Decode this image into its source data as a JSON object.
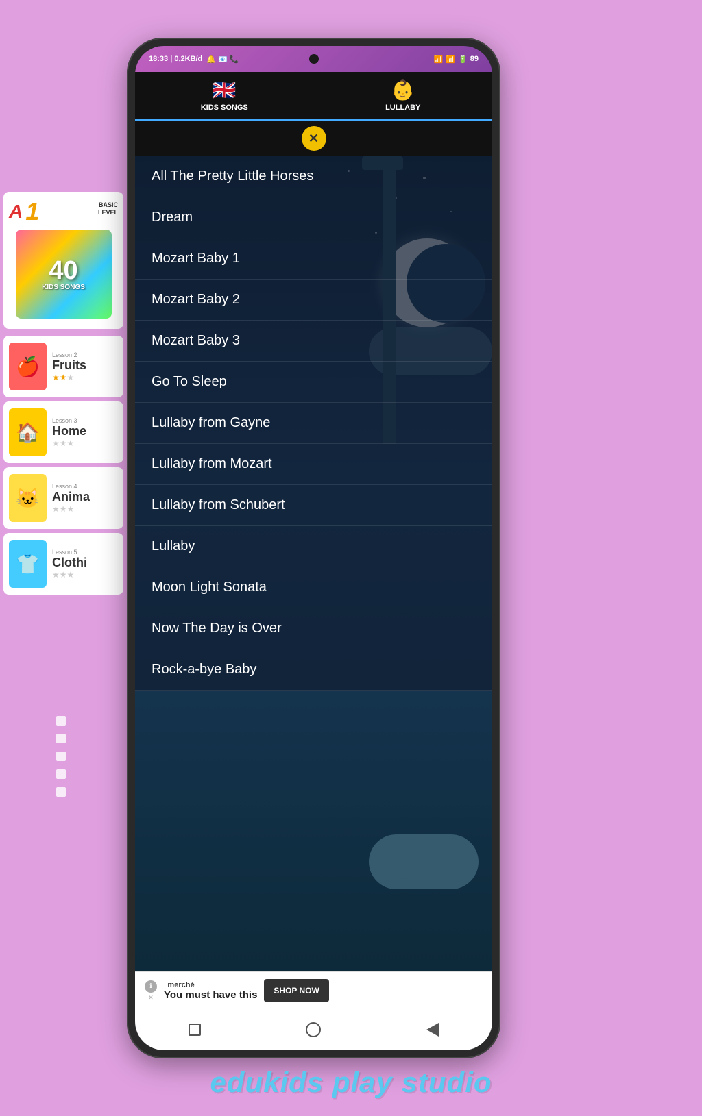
{
  "page": {
    "background_color": "#e0a0e0",
    "branding": "edukids play studio"
  },
  "status_bar": {
    "time": "18:33 | 0,2KB/d",
    "icons_left": "🔔 📧 📞",
    "battery": "89"
  },
  "tabs": [
    {
      "id": "kids-songs",
      "label": "KIDS SONGS",
      "emoji": "🇬🇧",
      "active": false
    },
    {
      "id": "lullaby",
      "label": "LULLABY",
      "emoji": "👶",
      "active": true
    }
  ],
  "close_button_label": "✕",
  "songs": [
    {
      "id": 1,
      "title": "All The Pretty Little Horses"
    },
    {
      "id": 2,
      "title": "Dream"
    },
    {
      "id": 3,
      "title": "Mozart Baby 1"
    },
    {
      "id": 4,
      "title": "Mozart Baby 2"
    },
    {
      "id": 5,
      "title": "Mozart Baby 3"
    },
    {
      "id": 6,
      "title": "Go To Sleep"
    },
    {
      "id": 7,
      "title": "Lullaby from Gayne"
    },
    {
      "id": 8,
      "title": "Lullaby from Mozart"
    },
    {
      "id": 9,
      "title": "Lullaby from Schubert"
    },
    {
      "id": 10,
      "title": "Lullaby"
    },
    {
      "id": 11,
      "title": "Moon Light Sonata"
    },
    {
      "id": 12,
      "title": "Now The Day is Over"
    },
    {
      "id": 13,
      "title": "Rock-a-bye Baby"
    }
  ],
  "ad": {
    "brand": "merche",
    "brand_styled": "merché",
    "text": "You must have this",
    "button_label": "SHOP NOW"
  },
  "sidebar": {
    "top_card": {
      "a1": "A",
      "num": "1",
      "basic_label": "BASIC",
      "level_label": "LEVEL",
      "forty": "40",
      "kids_songs": "KIDS SONGS"
    },
    "lessons": [
      {
        "id": 2,
        "name": "Fruits",
        "icon": "🍎",
        "color": "#ff6060",
        "stars": 2
      },
      {
        "id": 3,
        "name": "Home",
        "icon": "🏠",
        "color": "#ffcc00",
        "stars": 0
      },
      {
        "id": 4,
        "name": "Animals",
        "icon": "🐱",
        "color": "#ffdd44",
        "stars": 0
      },
      {
        "id": 5,
        "name": "Clothing",
        "icon": "👕",
        "color": "#44ccff",
        "stars": 0
      }
    ]
  },
  "nav_bar": {
    "square_label": "■",
    "circle_label": "○",
    "back_label": "◄"
  }
}
